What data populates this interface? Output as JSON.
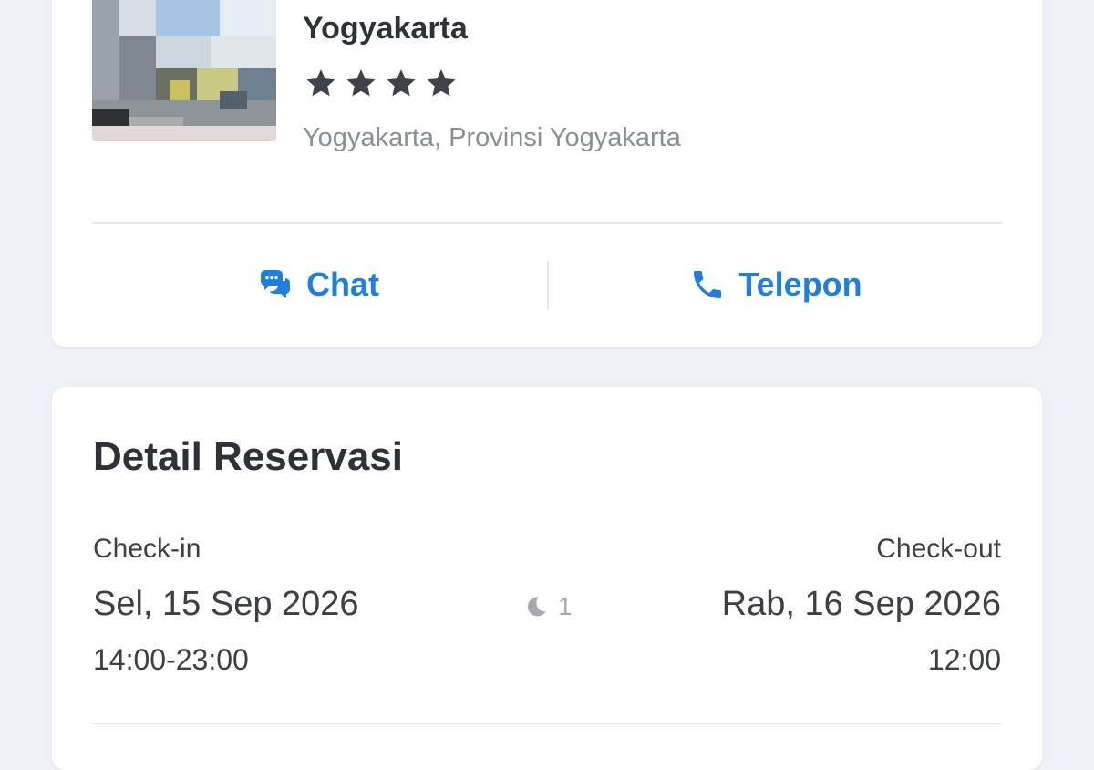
{
  "hotel": {
    "name": "Yogyakarta",
    "rating": 4,
    "location": "Yogyakarta, Provinsi Yogyakarta",
    "actions": {
      "chat_label": "Chat",
      "call_label": "Telepon",
      "accent": "#1f7fe0"
    }
  },
  "reservation": {
    "title": "Detail Reservasi",
    "checkin": {
      "label": "Check-in",
      "date": "Sel, 15 Sep 2026",
      "time": "14:00-23:00"
    },
    "checkout": {
      "label": "Check-out",
      "date": "Rab, 16 Sep 2026",
      "time": "12:00"
    },
    "nights": "1"
  },
  "icons": {
    "chat": "chat-bubbles-icon",
    "call": "phone-icon",
    "nights": "moon-icon",
    "rating": "star-icon"
  },
  "colors": {
    "background": "#eef0f7",
    "card": "#ffffff",
    "text": "#2e3138",
    "muted": "#8b8e96",
    "accent": "#1f7fe0",
    "star": "#3f424b"
  }
}
